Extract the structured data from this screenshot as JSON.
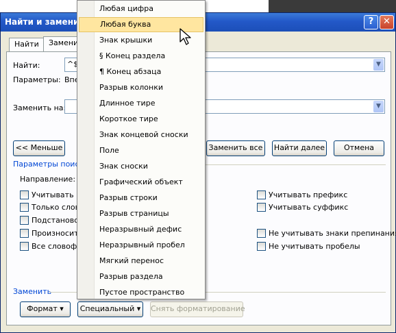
{
  "window": {
    "title": "Найти и заменит",
    "help_label": "?",
    "close_label": "✕"
  },
  "tabs": [
    "Найти",
    "Заменит"
  ],
  "find": {
    "label": "Найти:",
    "value": "^$",
    "params_label": "Параметры:",
    "params_value": "Впе"
  },
  "replace": {
    "label": "Заменить на:",
    "value": ""
  },
  "buttons": {
    "less": "<< Меньше",
    "replace_all": "Заменить все",
    "find_next": "Найти далее",
    "cancel": "Отмена",
    "format": "Формат",
    "special": "Специальный",
    "clear_format": "Снять форматирование"
  },
  "search_params": {
    "title": "Параметры поиска",
    "direction_label": "Направление:",
    "left_options": [
      "Учитывать р",
      "Только слово",
      "Подстановоч",
      "Произносится",
      "Все словофор"
    ],
    "right_options": [
      "Учитывать префикс",
      "Учитывать суффикс",
      "Не учитывать знаки препинания",
      "Не учитывать пробелы"
    ]
  },
  "replace_section_title": "Заменить",
  "special_menu": {
    "items": [
      "Любая цифра",
      "Любая буква",
      "Знак крышки",
      "§ Конец раздела",
      "¶ Конец абзаца",
      "Разрыв колонки",
      "Длинное тире",
      "Короткое тире",
      "Знак концевой сноски",
      "Поле",
      "Знак сноски",
      "Графический объект",
      "Разрыв строки",
      "Разрыв страницы",
      "Неразрывный дефис",
      "Неразрывный пробел",
      "Мягкий перенос",
      "Разрыв раздела",
      "Пустое пространство"
    ],
    "highlighted": "Любая буква"
  },
  "colors": {
    "title_bar": "#2358c8",
    "menu_highlight": "#ffe6a0",
    "section_title": "#0046d5"
  }
}
